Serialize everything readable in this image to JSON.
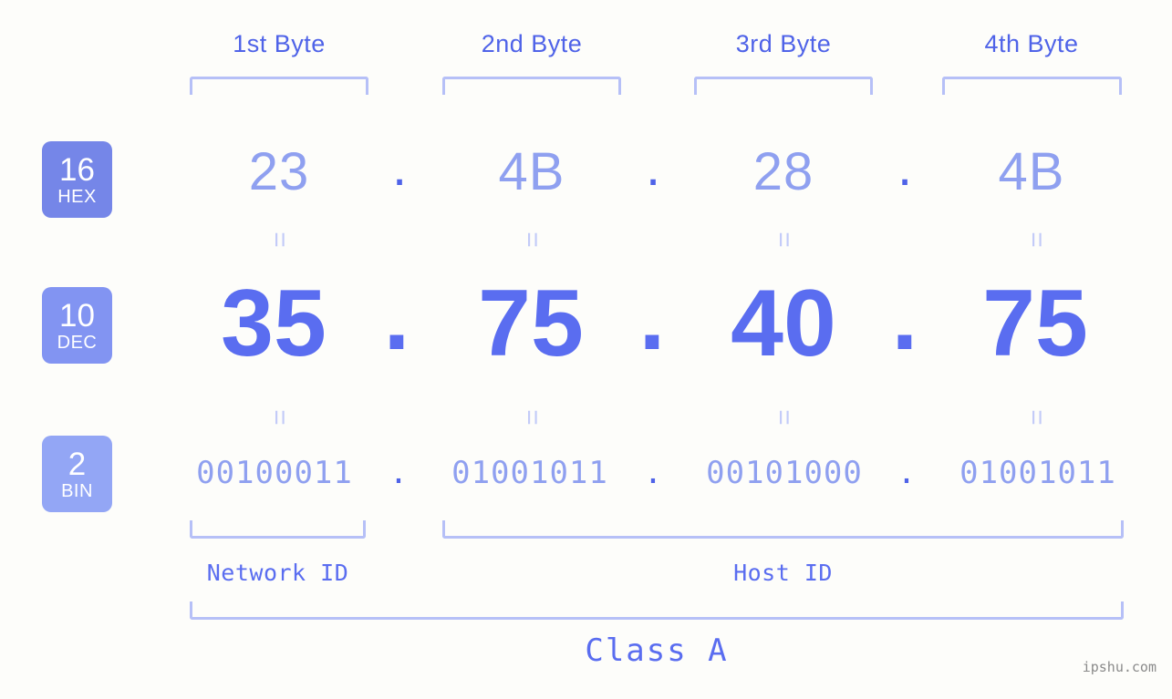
{
  "background_color": "#fdfdfa",
  "byte_headers": [
    {
      "label": "1st Byte"
    },
    {
      "label": "2nd Byte"
    },
    {
      "label": "3rd Byte"
    },
    {
      "label": "4th Byte"
    }
  ],
  "bases": [
    {
      "number": "16",
      "name": "HEX",
      "color": "#7586e8"
    },
    {
      "number": "10",
      "name": "DEC",
      "color": "#8294f2"
    },
    {
      "number": "2",
      "name": "BIN",
      "color": "#93a6f5"
    }
  ],
  "rows": {
    "hex": {
      "base_number": "16",
      "base_name": "HEX",
      "values": [
        "23",
        "4B",
        "28",
        "4B"
      ],
      "separator": ".",
      "color": "#8fa0f0",
      "separator_color": "#4f63e8"
    },
    "dec": {
      "base_number": "10",
      "base_name": "DEC",
      "values": [
        "35",
        "75",
        "40",
        "75"
      ],
      "separator": ".",
      "color": "#5a6df0",
      "separator_color": "#5a6df0"
    },
    "bin": {
      "base_number": "2",
      "base_name": "BIN",
      "values": [
        "00100011",
        "01001011",
        "00101000",
        "01001011"
      ],
      "separator": ".",
      "color": "#8fa0f0",
      "separator_color": "#4f63e8"
    }
  },
  "equals_marks": {
    "symbol": "=",
    "color": "#c3cbf8"
  },
  "segments": {
    "network_id_label": "Network ID",
    "host_id_label": "Host ID",
    "class_label": "Class A"
  },
  "watermark": "ipshu.com",
  "accent_color": "#5a6df0",
  "bracket_color": "#b6c0f7"
}
